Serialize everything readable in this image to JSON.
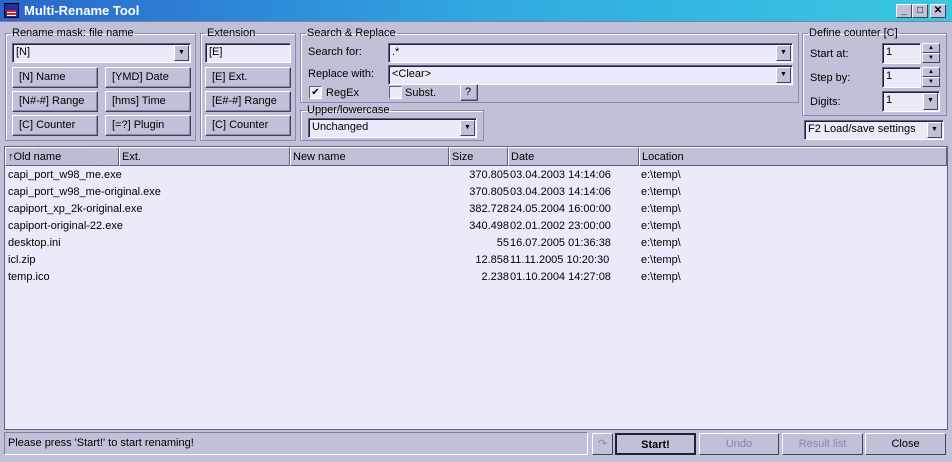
{
  "window": {
    "title": "Multi-Rename Tool"
  },
  "rename_mask": {
    "legend": "Rename mask: file name",
    "value": "[N]",
    "buttons": [
      "[N]  Name",
      "[YMD]  Date",
      "[N#-#] Range",
      "[hms]  Time",
      "[C]  Counter",
      "[=?]  Plugin"
    ]
  },
  "extension": {
    "legend": "Extension",
    "value": "[E]",
    "buttons": [
      "[E]  Ext.",
      "[E#-#] Range",
      "[C]  Counter"
    ]
  },
  "search_replace": {
    "legend": "Search & Replace",
    "search_label": "Search for:",
    "search_value": ".*",
    "replace_label": "Replace with:",
    "replace_value": "<Clear>",
    "regex_label": "RegEx",
    "regex_checked": true,
    "subst_label": "Subst.",
    "subst_checked": false,
    "help_label": "?"
  },
  "case": {
    "legend": "Upper/lowercase",
    "value": "Unchanged"
  },
  "counter": {
    "legend": "Define counter [C]",
    "start_label": "Start at:",
    "start_value": "1",
    "step_label": "Step by:",
    "step_value": "1",
    "digits_label": "Digits:",
    "digits_value": "1"
  },
  "settings": {
    "value": "F2 Load/save settings"
  },
  "list": {
    "columns": [
      "Old name",
      "Ext.",
      "New name",
      "Size",
      "Date",
      "Location"
    ],
    "rows": [
      {
        "old": "capi_port_w98_me.exe",
        "size": "370.805",
        "date": "03.04.2003 14:14:06",
        "loc": "e:\\temp\\"
      },
      {
        "old": "capi_port_w98_me-original.exe",
        "size": "370.805",
        "date": "03.04.2003 14:14:06",
        "loc": "e:\\temp\\"
      },
      {
        "old": "capiport_xp_2k-original.exe",
        "size": "382.728",
        "date": "24.05.2004 16:00:00",
        "loc": "e:\\temp\\"
      },
      {
        "old": "capiport-original-22.exe",
        "size": "340.498",
        "date": "02.01.2002 23:00:00",
        "loc": "e:\\temp\\"
      },
      {
        "old": "desktop.ini",
        "size": "55",
        "date": "16.07.2005 01:36:38",
        "loc": "e:\\temp\\"
      },
      {
        "old": "icl.zip",
        "size": "12.858",
        "date": "11.11.2005 10:20:30",
        "loc": "e:\\temp\\"
      },
      {
        "old": "temp.ico",
        "size": "2.238",
        "date": "01.10.2004 14:27:08",
        "loc": "e:\\temp\\"
      }
    ]
  },
  "status": "Please press 'Start!' to start renaming!",
  "buttons": {
    "start": "Start!",
    "undo": "Undo",
    "result": "Result list",
    "close": "Close"
  }
}
